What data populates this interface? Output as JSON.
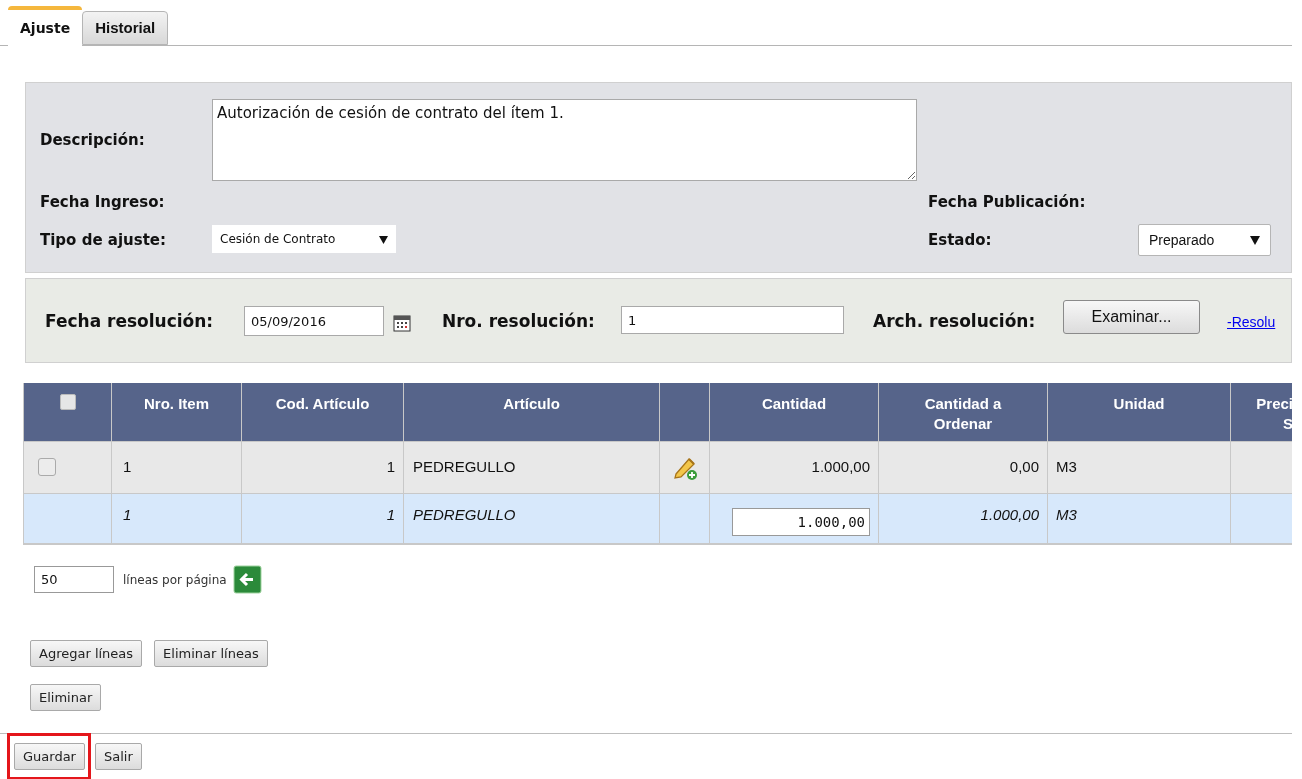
{
  "tabs": [
    {
      "label": "Ajuste",
      "selected": true
    },
    {
      "label": "Historial",
      "selected": false
    }
  ],
  "header_form": {
    "descripcion_label": "Descripción:",
    "descripcion_value": "Autorización de cesión de contrato del ítem 1.",
    "fecha_ingreso_label": "Fecha Ingreso:",
    "fecha_publicacion_label": "Fecha Publicación:",
    "tipo_label": "Tipo de ajuste:",
    "tipo_value": "Cesión de Contrato",
    "estado_label": "Estado:",
    "estado_value": "Preparado"
  },
  "resolution": {
    "fecha_label": "Fecha resolución:",
    "fecha_value": "05/09/2016",
    "nro_label": "Nro. resolución:",
    "nro_value": "1",
    "arch_label": "Arch. resolución:",
    "browse_button": "Examinar...",
    "link": "-Resolu"
  },
  "table": {
    "select_all_checked": false,
    "columns": [
      {
        "label": "Nro. Item"
      },
      {
        "label": "Cod. Artículo"
      },
      {
        "label": "Artículo"
      },
      {
        "label": "Cantidad"
      },
      {
        "label": "Cantidad a Ordenar"
      },
      {
        "label": "Unidad"
      },
      {
        "label": "Preci S"
      }
    ],
    "rows": [
      {
        "kind": "item",
        "checked": false,
        "nro": "1",
        "cod": "1",
        "articulo": "PEDREGULLO",
        "cantidad": "1.000,00",
        "a_ordenar": "0,00",
        "unidad": "M3"
      },
      {
        "kind": "edit",
        "nro": "1",
        "cod": "1",
        "articulo": "PEDREGULLO",
        "cantidad": "1.000,00",
        "a_ordenar": "1.000,00",
        "unidad": "M3"
      }
    ]
  },
  "pager": {
    "lines_value": "50",
    "label": "líneas por página"
  },
  "buttons": [
    "Agregar líneas",
    "Eliminar líneas"
  ],
  "delete_button": "Eliminar",
  "footer_buttons": [
    {
      "label": "Guardar",
      "highlighted": true
    },
    {
      "label": "Salir",
      "highlighted": false
    }
  ]
}
